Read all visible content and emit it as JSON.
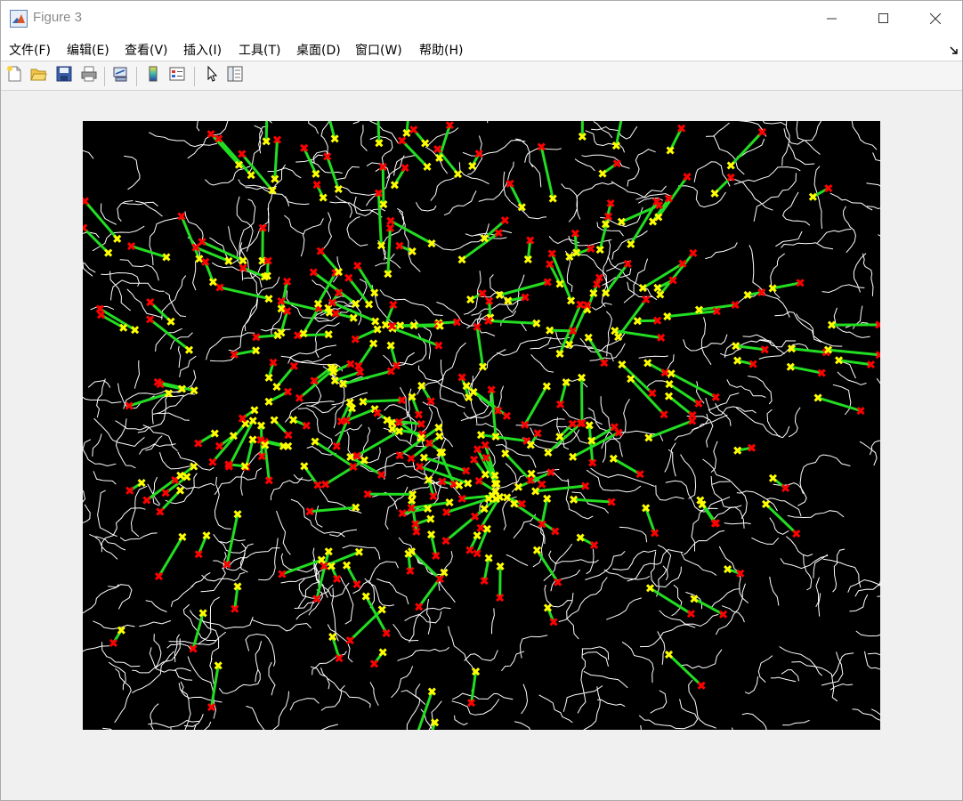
{
  "window": {
    "title": "Figure 3",
    "icon": "matlab-icon",
    "controls": {
      "minimize": "minimize-icon",
      "maximize": "maximize-icon",
      "close": "close-icon"
    }
  },
  "menubar": {
    "items": [
      {
        "label": "文件(F)"
      },
      {
        "label": "编辑(E)"
      },
      {
        "label": "查看(V)"
      },
      {
        "label": "插入(I)"
      },
      {
        "label": "工具(T)"
      },
      {
        "label": "桌面(D)"
      },
      {
        "label": "窗口(W)"
      },
      {
        "label": "帮助(H)"
      }
    ],
    "dock_icon": "dock-arrow-icon"
  },
  "toolbar": {
    "buttons": [
      {
        "name": "new-figure-button",
        "icon": "new-file-icon"
      },
      {
        "name": "open-file-button",
        "icon": "folder-open-icon"
      },
      {
        "name": "save-figure-button",
        "icon": "save-disk-icon"
      },
      {
        "name": "print-figure-button",
        "icon": "printer-icon"
      },
      {
        "name": "link-plot-button",
        "icon": "link-plot-icon"
      },
      {
        "name": "insert-colorbar-button",
        "icon": "colorbar-icon"
      },
      {
        "name": "insert-legend-button",
        "icon": "legend-icon"
      },
      {
        "name": "edit-plot-button",
        "icon": "pointer-arrow-icon"
      },
      {
        "name": "property-inspector-button",
        "icon": "property-panel-icon"
      }
    ]
  },
  "figure": {
    "background": "#000000",
    "colors": {
      "edges": "#ffffff",
      "line_segments": "#22dd22",
      "start_points": "#ffff00",
      "end_points": "#ff0000"
    }
  }
}
